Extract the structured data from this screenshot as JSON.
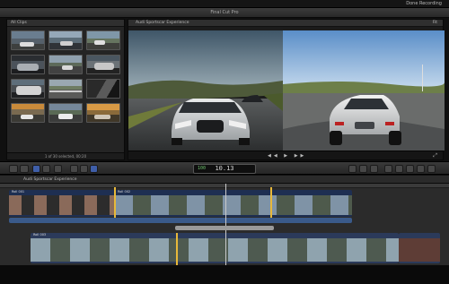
{
  "menubar": {
    "right_label": "Done Recording"
  },
  "window": {
    "title": "Final Cut Pro"
  },
  "browser": {
    "header": "All Clips",
    "footer": "1 of 30 selected, 00:20",
    "thumbs": [
      "track-car",
      "garage-car",
      "car-road",
      "car-side",
      "road-pan",
      "car-front",
      "car-close",
      "racetrack",
      "car-interior",
      "sunset-road",
      "car-pit",
      "sunset-car"
    ]
  },
  "viewer": {
    "header": "Audi Sportscar Experience",
    "zoom": "Fit"
  },
  "toolbar": {
    "timecode": "10.13",
    "timecode_prefix": "100"
  },
  "timeline": {
    "header": "Audi Sportscar Experience",
    "clip1": "Roll 001",
    "clip2": "Roll 002",
    "clip3": "Roll 003"
  },
  "colors": {
    "accent": "#3f5ea8",
    "playhead": "#c9c9c9",
    "range": "#e7b83a"
  }
}
